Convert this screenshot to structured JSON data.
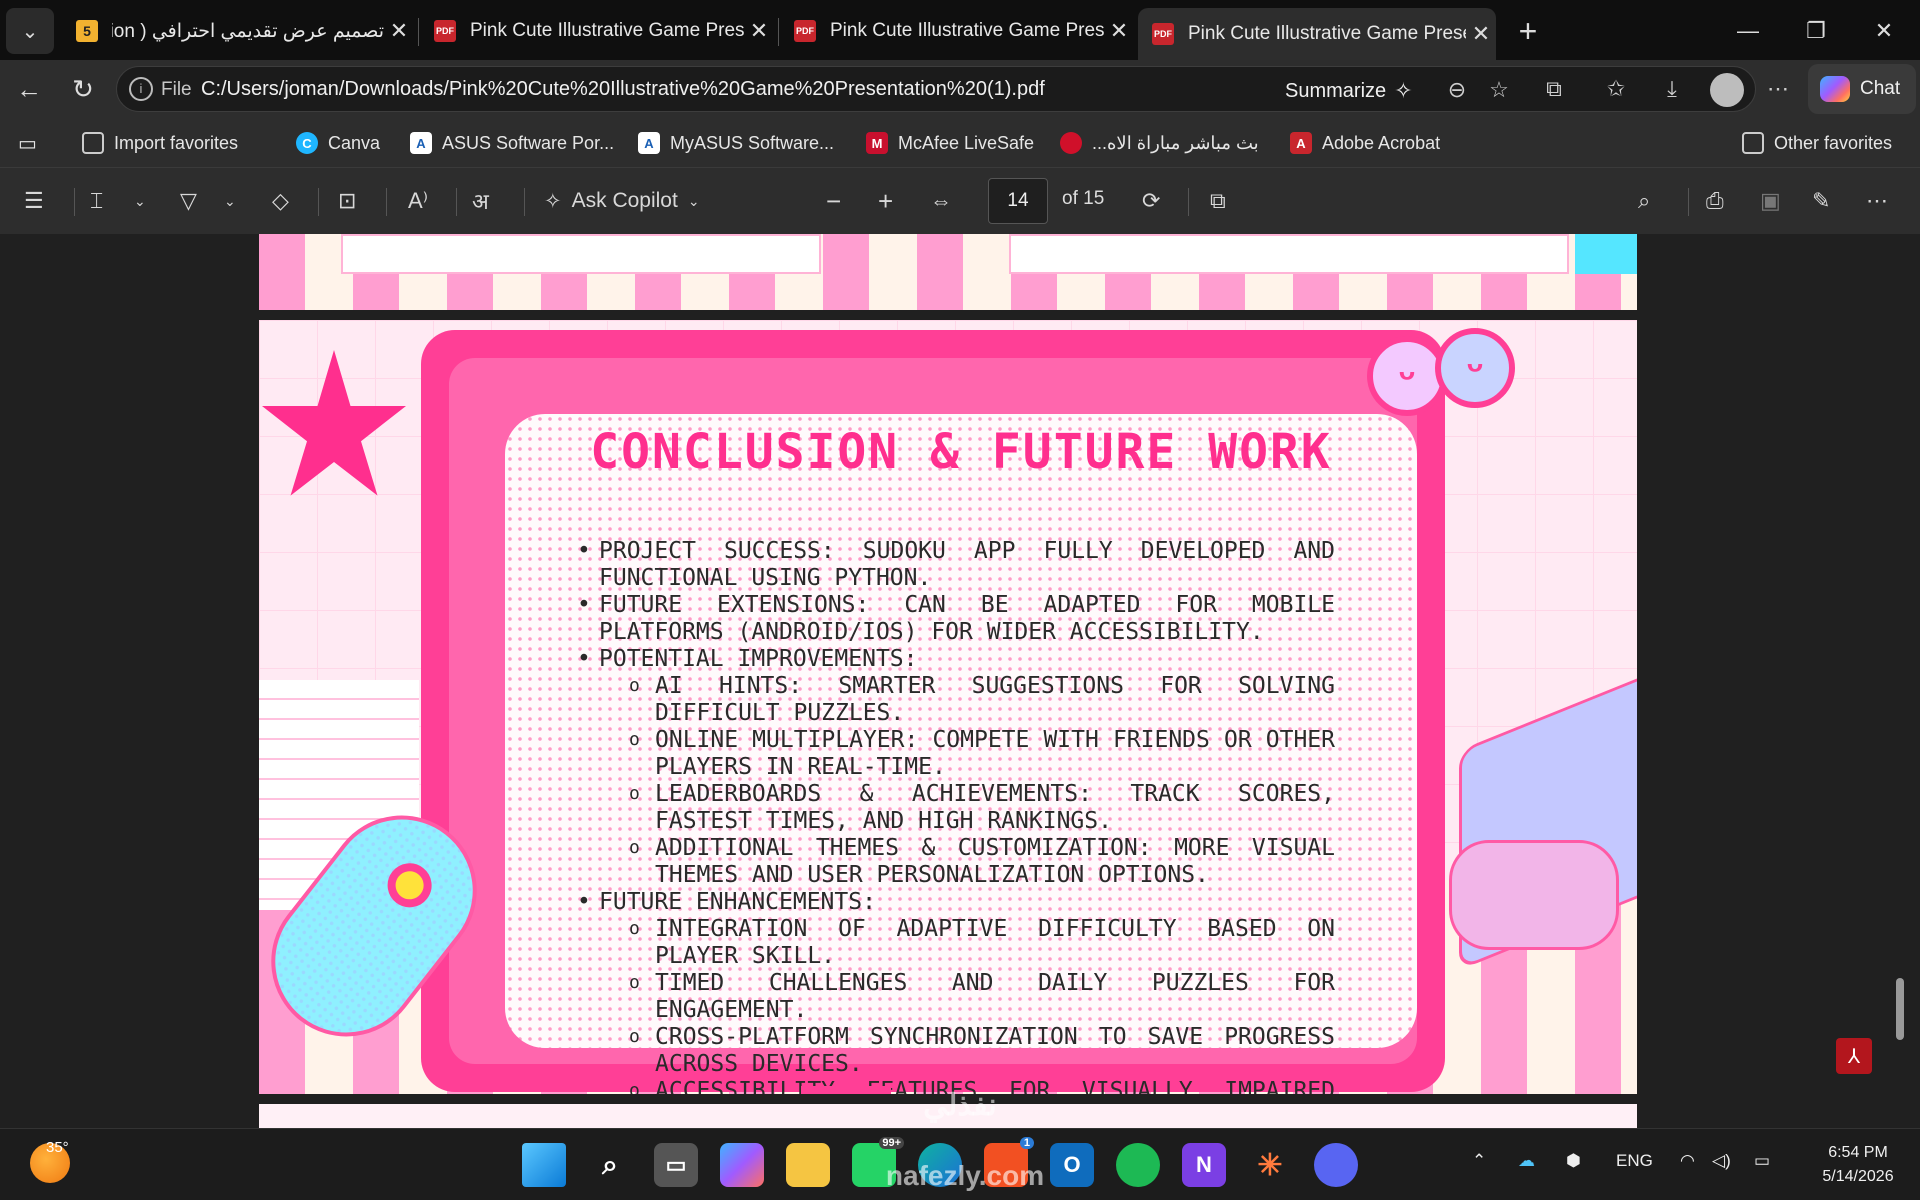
{
  "tabs": [
    {
      "title": "تصميم عرض تقديمي احترافي ( ation",
      "favicon": "5"
    },
    {
      "title": "Pink Cute Illustrative Game Presen",
      "favicon": "PDF"
    },
    {
      "title": "Pink Cute Illustrative Game Presen",
      "favicon": "PDF"
    },
    {
      "title": "Pink Cute Illustrative Game Presen",
      "favicon": "PDF",
      "active": true
    }
  ],
  "address": {
    "scheme_label": "File",
    "url": "C:/Users/joman/Downloads/Pink%20Cute%20Illustrative%20Game%20Presentation%20(1).pdf",
    "summarize_label": "Summarize",
    "chat_label": "Chat"
  },
  "favorites": [
    {
      "label": "Import favorites",
      "icon": "import-icon"
    },
    {
      "label": "Canva",
      "icon": "canva-icon",
      "color": "#1fb6ff"
    },
    {
      "label": "ASUS Software Por...",
      "icon": "asus-icon"
    },
    {
      "label": "MyASUS Software...",
      "icon": "asus-icon"
    },
    {
      "label": "McAfee LiveSafe",
      "icon": "mcafee-icon",
      "color": "#c8102e"
    },
    {
      "label": "بث مباشر مباراة الاه...",
      "icon": "site-icon",
      "color": "#d0102a"
    },
    {
      "label": "Adobe Acrobat",
      "icon": "acrobat-icon",
      "color": "#c8262d"
    },
    {
      "label": "Other favorites",
      "icon": "folder-icon"
    }
  ],
  "pdf_toolbar": {
    "ask_copilot": "Ask Copilot",
    "page_current": "14",
    "page_total_label": "of 15"
  },
  "slide": {
    "title": "CONCLUSION & FUTURE WORK",
    "bullets": [
      {
        "level": 1,
        "text": "PROJECT SUCCESS: SUDOKU APP FULLY DEVELOPED AND FUNCTIONAL USING PYTHON."
      },
      {
        "level": 1,
        "text": "FUTURE EXTENSIONS: CAN BE ADAPTED FOR MOBILE PLATFORMS (ANDROID/IOS) FOR WIDER ACCESSIBILITY."
      },
      {
        "level": 1,
        "text": "POTENTIAL IMPROVEMENTS:"
      },
      {
        "level": 2,
        "text": "AI HINTS: SMARTER SUGGESTIONS FOR SOLVING DIFFICULT PUZZLES."
      },
      {
        "level": 2,
        "text": "ONLINE MULTIPLAYER: COMPETE WITH FRIENDS OR OTHER PLAYERS IN REAL-TIME."
      },
      {
        "level": 2,
        "text": "LEADERBOARDS & ACHIEVEMENTS: TRACK SCORES, FASTEST TIMES, AND HIGH RANKINGS."
      },
      {
        "level": 2,
        "text": "ADDITIONAL THEMES & CUSTOMIZATION: MORE VISUAL THEMES AND USER PERSONALIZATION OPTIONS."
      },
      {
        "level": 1,
        "text": "FUTURE ENHANCEMENTS:"
      },
      {
        "level": 2,
        "text": "INTEGRATION OF ADAPTIVE DIFFICULTY BASED ON PLAYER SKILL."
      },
      {
        "level": 2,
        "text": "TIMED CHALLENGES AND DAILY PUZZLES FOR ENGAGEMENT."
      },
      {
        "level": 2,
        "text": "CROSS-PLATFORM SYNCHRONIZATION TO SAVE PROGRESS ACROSS DEVICES."
      },
      {
        "level": 2,
        "text": "ACCESSIBILITY FEATURES FOR VISUALLY IMPAIRED USERS."
      }
    ]
  },
  "taskbar": {
    "weather_temp": "35°",
    "language": "ENG",
    "time": "6:54 PM",
    "date": "5/14/2026",
    "badge_whatsapp": "99+",
    "badge_store": "1"
  },
  "watermark": {
    "arabic": "نفذلي",
    "latin": "nafezly.com"
  },
  "colors": {
    "accent_pink": "#ff3f96",
    "tab_bg": "#0f0f0f",
    "toolbar_bg": "#2d2d2d"
  }
}
